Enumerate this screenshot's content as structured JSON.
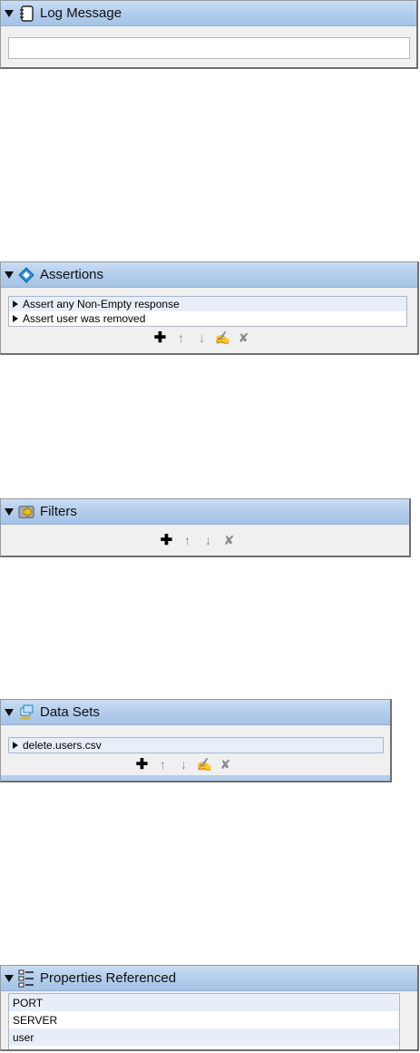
{
  "log_message": {
    "title": "Log Message",
    "value": ""
  },
  "assertions": {
    "title": "Assertions",
    "items": [
      "Assert any Non-Empty response",
      "Assert user was removed"
    ]
  },
  "filters": {
    "title": "Filters"
  },
  "data_sets": {
    "title": "Data Sets",
    "items": [
      "delete.users.csv"
    ]
  },
  "properties": {
    "title": "Properties Referenced",
    "items": [
      "PORT",
      "SERVER",
      "user"
    ]
  },
  "toolbar": {
    "add": "✚",
    "up": "↑",
    "down": "↓",
    "edit": "✍",
    "delete": "✘"
  }
}
